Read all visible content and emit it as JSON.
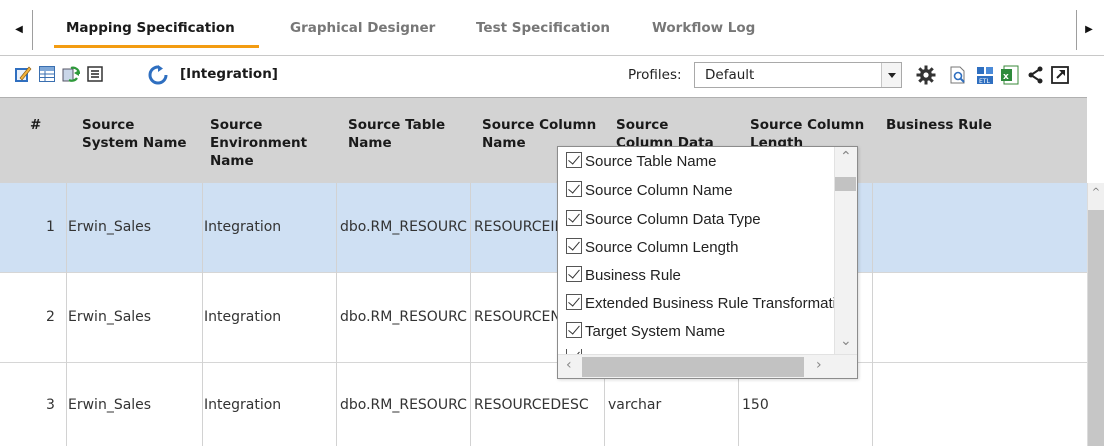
{
  "tabs": [
    {
      "label": "Mapping Specification",
      "active": true
    },
    {
      "label": "Graphical Designer",
      "active": false
    },
    {
      "label": "Test Specification",
      "active": false
    },
    {
      "label": "Workflow Log",
      "active": false
    }
  ],
  "toolbar": {
    "scope_label": "[Integration]",
    "profiles_label": "Profiles:",
    "profile_value": "Default",
    "left_icons": [
      "edit-icon",
      "grid-icon",
      "sync-icon",
      "list-icon",
      "refresh-icon"
    ],
    "right_icons": [
      "settings-icon",
      "preview-icon",
      "etl-icon",
      "excel-icon",
      "share-icon",
      "popout-icon"
    ]
  },
  "table": {
    "columns": [
      "#",
      "Source System Name",
      "Source Environment Name",
      "Source Table Name",
      "Source Column Name",
      "Source Column Data Type",
      "Source Column Length",
      "Business Rule"
    ],
    "rows": [
      {
        "num": "1",
        "system": "Erwin_Sales",
        "env": "Integration",
        "table": "dbo.RM_RESOURC",
        "column": "RESOURCEID",
        "dtype": "",
        "length": "",
        "rule": "",
        "selected": true
      },
      {
        "num": "2",
        "system": "Erwin_Sales",
        "env": "Integration",
        "table": "dbo.RM_RESOURC",
        "column": "RESOURCEN",
        "dtype": "",
        "length": "",
        "rule": "",
        "selected": false
      },
      {
        "num": "3",
        "system": "Erwin_Sales",
        "env": "Integration",
        "table": "dbo.RM_RESOURC",
        "column": "RESOURCEDESC",
        "dtype": "varchar",
        "length": "150",
        "rule": "",
        "selected": false
      }
    ]
  },
  "column_chooser": {
    "items": [
      {
        "label": "Source Table Name",
        "checked": true
      },
      {
        "label": "Source Column Name",
        "checked": true
      },
      {
        "label": "Source Column Data Type",
        "checked": true
      },
      {
        "label": "Source Column Length",
        "checked": true
      },
      {
        "label": "Business Rule",
        "checked": true
      },
      {
        "label": "Extended Business Rule Transformatic",
        "checked": true
      },
      {
        "label": "Target System Name",
        "checked": true
      }
    ]
  },
  "colors": {
    "accent": "#f39c12",
    "header_bg": "#d3d3d3",
    "selected_row": "#cfe0f3"
  }
}
